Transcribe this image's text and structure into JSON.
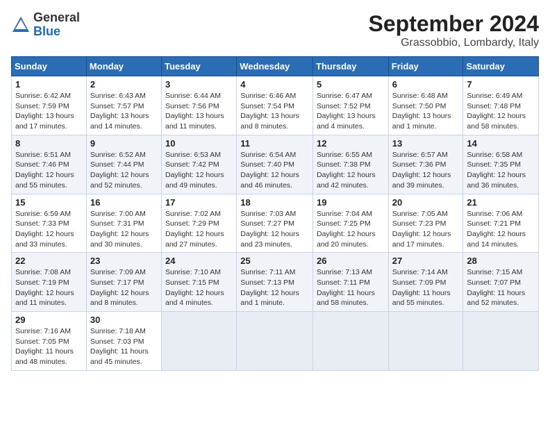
{
  "header": {
    "logo_general": "General",
    "logo_blue": "Blue",
    "month_title": "September 2024",
    "location": "Grassobbio, Lombardy, Italy"
  },
  "weekdays": [
    "Sunday",
    "Monday",
    "Tuesday",
    "Wednesday",
    "Thursday",
    "Friday",
    "Saturday"
  ],
  "weeks": [
    [
      {
        "day": "1",
        "info": "Sunrise: 6:42 AM\nSunset: 7:59 PM\nDaylight: 13 hours\nand 17 minutes."
      },
      {
        "day": "2",
        "info": "Sunrise: 6:43 AM\nSunset: 7:57 PM\nDaylight: 13 hours\nand 14 minutes."
      },
      {
        "day": "3",
        "info": "Sunrise: 6:44 AM\nSunset: 7:56 PM\nDaylight: 13 hours\nand 11 minutes."
      },
      {
        "day": "4",
        "info": "Sunrise: 6:46 AM\nSunset: 7:54 PM\nDaylight: 13 hours\nand 8 minutes."
      },
      {
        "day": "5",
        "info": "Sunrise: 6:47 AM\nSunset: 7:52 PM\nDaylight: 13 hours\nand 4 minutes."
      },
      {
        "day": "6",
        "info": "Sunrise: 6:48 AM\nSunset: 7:50 PM\nDaylight: 13 hours\nand 1 minute."
      },
      {
        "day": "7",
        "info": "Sunrise: 6:49 AM\nSunset: 7:48 PM\nDaylight: 12 hours\nand 58 minutes."
      }
    ],
    [
      {
        "day": "8",
        "info": "Sunrise: 6:51 AM\nSunset: 7:46 PM\nDaylight: 12 hours\nand 55 minutes."
      },
      {
        "day": "9",
        "info": "Sunrise: 6:52 AM\nSunset: 7:44 PM\nDaylight: 12 hours\nand 52 minutes."
      },
      {
        "day": "10",
        "info": "Sunrise: 6:53 AM\nSunset: 7:42 PM\nDaylight: 12 hours\nand 49 minutes."
      },
      {
        "day": "11",
        "info": "Sunrise: 6:54 AM\nSunset: 7:40 PM\nDaylight: 12 hours\nand 46 minutes."
      },
      {
        "day": "12",
        "info": "Sunrise: 6:55 AM\nSunset: 7:38 PM\nDaylight: 12 hours\nand 42 minutes."
      },
      {
        "day": "13",
        "info": "Sunrise: 6:57 AM\nSunset: 7:36 PM\nDaylight: 12 hours\nand 39 minutes."
      },
      {
        "day": "14",
        "info": "Sunrise: 6:58 AM\nSunset: 7:35 PM\nDaylight: 12 hours\nand 36 minutes."
      }
    ],
    [
      {
        "day": "15",
        "info": "Sunrise: 6:59 AM\nSunset: 7:33 PM\nDaylight: 12 hours\nand 33 minutes."
      },
      {
        "day": "16",
        "info": "Sunrise: 7:00 AM\nSunset: 7:31 PM\nDaylight: 12 hours\nand 30 minutes."
      },
      {
        "day": "17",
        "info": "Sunrise: 7:02 AM\nSunset: 7:29 PM\nDaylight: 12 hours\nand 27 minutes."
      },
      {
        "day": "18",
        "info": "Sunrise: 7:03 AM\nSunset: 7:27 PM\nDaylight: 12 hours\nand 23 minutes."
      },
      {
        "day": "19",
        "info": "Sunrise: 7:04 AM\nSunset: 7:25 PM\nDaylight: 12 hours\nand 20 minutes."
      },
      {
        "day": "20",
        "info": "Sunrise: 7:05 AM\nSunset: 7:23 PM\nDaylight: 12 hours\nand 17 minutes."
      },
      {
        "day": "21",
        "info": "Sunrise: 7:06 AM\nSunset: 7:21 PM\nDaylight: 12 hours\nand 14 minutes."
      }
    ],
    [
      {
        "day": "22",
        "info": "Sunrise: 7:08 AM\nSunset: 7:19 PM\nDaylight: 12 hours\nand 11 minutes."
      },
      {
        "day": "23",
        "info": "Sunrise: 7:09 AM\nSunset: 7:17 PM\nDaylight: 12 hours\nand 8 minutes."
      },
      {
        "day": "24",
        "info": "Sunrise: 7:10 AM\nSunset: 7:15 PM\nDaylight: 12 hours\nand 4 minutes."
      },
      {
        "day": "25",
        "info": "Sunrise: 7:11 AM\nSunset: 7:13 PM\nDaylight: 12 hours\nand 1 minute."
      },
      {
        "day": "26",
        "info": "Sunrise: 7:13 AM\nSunset: 7:11 PM\nDaylight: 11 hours\nand 58 minutes."
      },
      {
        "day": "27",
        "info": "Sunrise: 7:14 AM\nSunset: 7:09 PM\nDaylight: 11 hours\nand 55 minutes."
      },
      {
        "day": "28",
        "info": "Sunrise: 7:15 AM\nSunset: 7:07 PM\nDaylight: 11 hours\nand 52 minutes."
      }
    ],
    [
      {
        "day": "29",
        "info": "Sunrise: 7:16 AM\nSunset: 7:05 PM\nDaylight: 11 hours\nand 48 minutes."
      },
      {
        "day": "30",
        "info": "Sunrise: 7:18 AM\nSunset: 7:03 PM\nDaylight: 11 hours\nand 45 minutes."
      },
      {
        "day": "",
        "info": "",
        "empty": true
      },
      {
        "day": "",
        "info": "",
        "empty": true
      },
      {
        "day": "",
        "info": "",
        "empty": true
      },
      {
        "day": "",
        "info": "",
        "empty": true
      },
      {
        "day": "",
        "info": "",
        "empty": true
      }
    ]
  ]
}
